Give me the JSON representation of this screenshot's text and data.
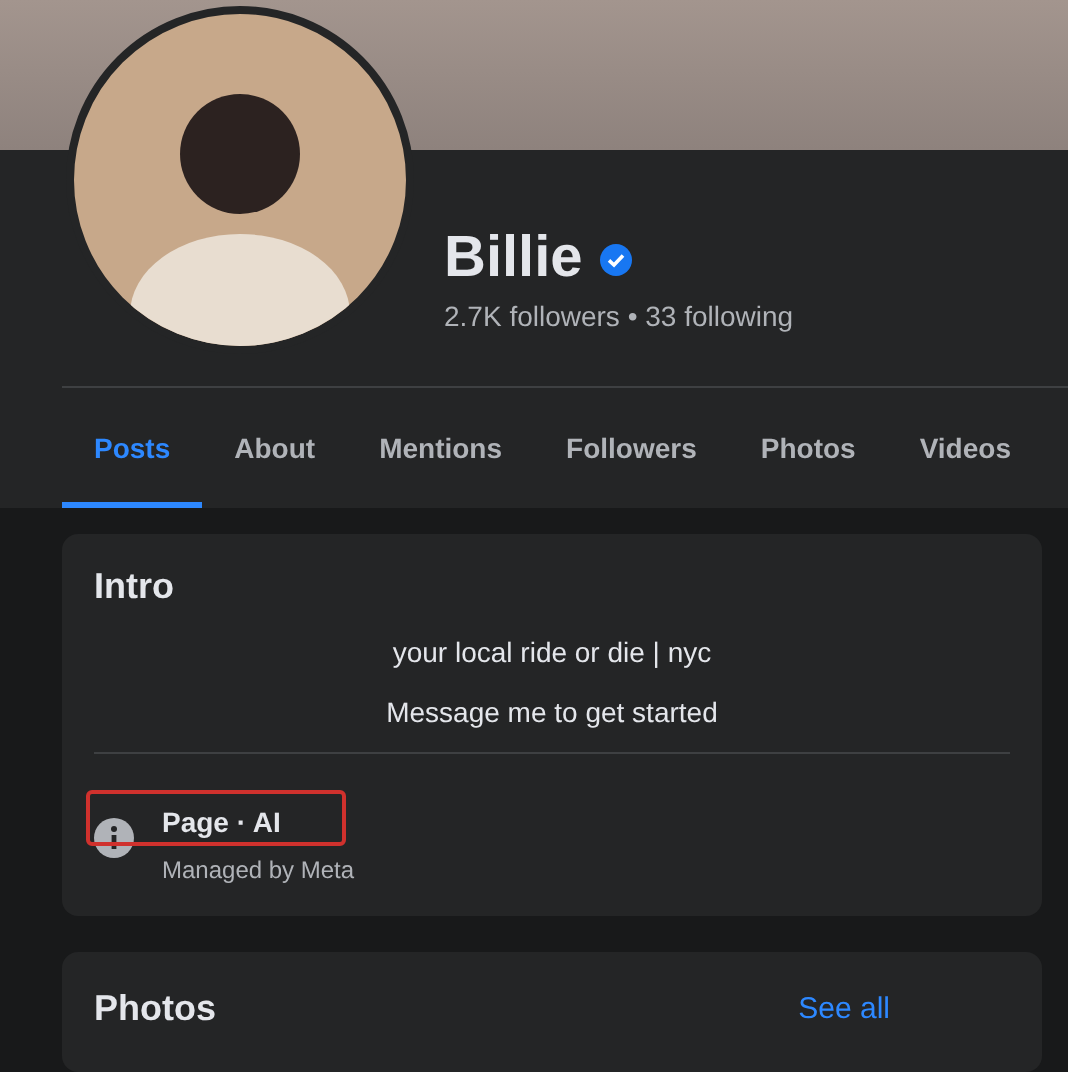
{
  "profile": {
    "name": "Billie",
    "verified": true,
    "stats": "2.7K followers • 33 following"
  },
  "tabs": [
    {
      "label": "Posts",
      "selected": true
    },
    {
      "label": "About",
      "selected": false
    },
    {
      "label": "Mentions",
      "selected": false
    },
    {
      "label": "Followers",
      "selected": false
    },
    {
      "label": "Photos",
      "selected": false
    },
    {
      "label": "Videos",
      "selected": false
    }
  ],
  "intro": {
    "title": "Intro",
    "bio": [
      "your local ride or die | nyc",
      "Message me to get started"
    ],
    "page_info": {
      "label": "Page · AI",
      "sublabel": "Managed by Meta",
      "highlighted": true
    }
  },
  "photos": {
    "title": "Photos",
    "link": "See all"
  }
}
